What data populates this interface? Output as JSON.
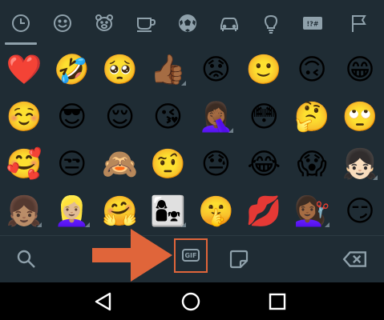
{
  "tabs": [
    {
      "icon": "recent-clock-icon",
      "active": true
    },
    {
      "icon": "smiley-icon",
      "active": false
    },
    {
      "icon": "bear-icon",
      "active": false
    },
    {
      "icon": "coffee-cup-icon",
      "active": false
    },
    {
      "icon": "soccer-ball-icon",
      "active": false
    },
    {
      "icon": "car-icon",
      "active": false
    },
    {
      "icon": "lightbulb-icon",
      "active": false
    },
    {
      "icon": "symbols-icon",
      "active": false
    },
    {
      "icon": "flag-icon",
      "active": false
    }
  ],
  "symbols_tab_text": "!?#",
  "emojis": [
    "❤️",
    "🤣",
    "🥺",
    "👍🏾",
    "😟",
    "🙂",
    "🙃",
    "😁",
    "☺️",
    "😎",
    "😌",
    "😘",
    "🤦🏾‍♀️",
    "😳",
    "🤔",
    "🙄",
    "🥰",
    "😒",
    "🙈",
    "🤨",
    "😓",
    "😂",
    "😱",
    "👧🏻",
    "👧🏽",
    "👱🏼‍♀️",
    "🤗",
    "👩‍👧",
    "🤫",
    "💋",
    "💇🏾‍♀️",
    "😏"
  ],
  "emoji_variants": [
    3,
    12,
    23,
    24,
    25,
    27,
    30
  ],
  "bottom_bar": {
    "search_icon": "search-icon",
    "gif_label": "GIF",
    "sticker_icon": "sticker-icon",
    "backspace_icon": "backspace-icon",
    "highlight_color": "#e0653a"
  },
  "navbar": {
    "back_icon": "back-triangle-icon",
    "home_icon": "home-circle-icon",
    "recents_icon": "recents-square-icon"
  },
  "colors": {
    "background": "#1f2c34",
    "icon": "#8fa1ab",
    "annotation_arrow": "#e0653a",
    "navbar": "#000000"
  }
}
